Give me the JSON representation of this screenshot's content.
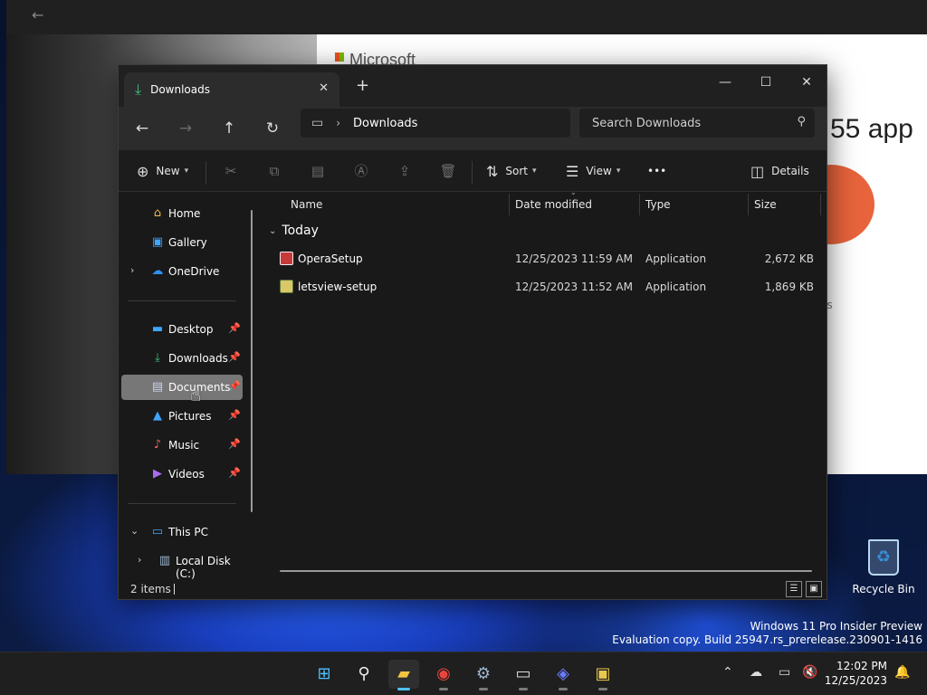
{
  "background_window": {
    "back_icon": "arrow-left-icon",
    "brand": "Microsoft",
    "headline": "55 app",
    "fragment": "os"
  },
  "explorer": {
    "tab_label": "Downloads",
    "new_tab_label": "+",
    "address": {
      "location": "Downloads"
    },
    "search": {
      "placeholder": "Search Downloads"
    },
    "commands": {
      "new_label": "New",
      "sort_label": "Sort",
      "view_label": "View",
      "more_label": "•••",
      "details_label": "Details"
    },
    "sidebar": {
      "items": [
        {
          "label": "Home",
          "icon": "home-icon"
        },
        {
          "label": "Gallery",
          "icon": "gallery-icon"
        },
        {
          "label": "OneDrive",
          "icon": "cloud-icon"
        },
        {
          "label": "Desktop",
          "icon": "desktop-icon"
        },
        {
          "label": "Downloads",
          "icon": "download-icon"
        },
        {
          "label": "Documents",
          "icon": "document-icon"
        },
        {
          "label": "Pictures",
          "icon": "pictures-icon"
        },
        {
          "label": "Music",
          "icon": "music-icon"
        },
        {
          "label": "Videos",
          "icon": "videos-icon"
        },
        {
          "label": "This PC",
          "icon": "computer-icon"
        },
        {
          "label": "Local Disk (C:)",
          "icon": "disk-icon"
        }
      ],
      "selected": "Documents"
    },
    "columns": [
      "Name",
      "Date modified",
      "Type",
      "Size"
    ],
    "group_label": "Today",
    "files": [
      {
        "name": "OperaSetup",
        "date": "12/25/2023 11:59 AM",
        "type": "Application",
        "size": "2,672 KB"
      },
      {
        "name": "letsview-setup",
        "date": "12/25/2023 11:52 AM",
        "type": "Application",
        "size": "1,869 KB"
      }
    ],
    "status": {
      "item_count": "2 items"
    }
  },
  "desktop": {
    "recycle_bin_label": "Recycle Bin",
    "watermark_line1": "Windows 11 Pro Insider Preview",
    "watermark_line2": "Evaluation copy. Build 25947.rs_prerelease.230901-1416"
  },
  "taskbar": {
    "time": "12:02 PM",
    "date": "12/25/2023"
  },
  "colors": {
    "accent": "#4cc2ff",
    "downloads_green": "#3cc37a",
    "selected_bg": "#777777"
  }
}
